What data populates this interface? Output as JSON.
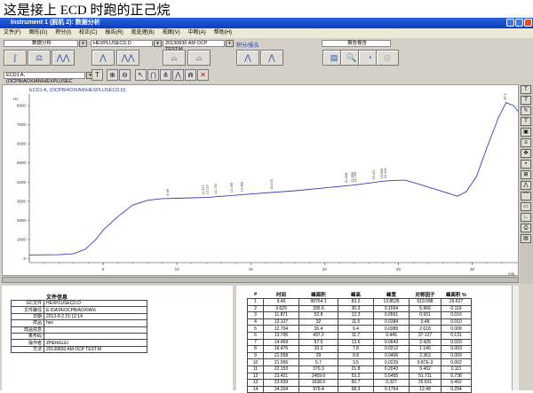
{
  "caption": "这是接上 ECD 时跑的正己烷",
  "window": {
    "title": "Instrument 1 (脱机 2): 数据分析"
  },
  "menu": [
    "文件(F)",
    "图形(G)",
    "积分(I)",
    "校正(C)",
    "报告(R)",
    "批处理(B)",
    "视图(V)",
    "中断(A)",
    "帮助(H)"
  ],
  "toolbar": {
    "view_combo": "数据分析",
    "file_combo": "HEXPLUSECD.D",
    "method_combo": "20130830 AM OCP TEST.M",
    "integration_label": "积分/报告",
    "report_combo": "报告报告",
    "signal_combo": "ECD1 A,  (OCPBIAOXIAN\\HEXPLUSEC"
  },
  "chart": {
    "signal_title": "ECD1 A,  (OCPBIAOXIAN\\HEXPLUSECD.D)",
    "y_unit": "Hz",
    "x_unit": "min",
    "y_ticks": [
      0,
      1000,
      2000,
      3000,
      4000,
      5000,
      6000,
      7000,
      8000
    ],
    "x_ticks": [
      5,
      10,
      15,
      20,
      25,
      30
    ],
    "x_range": [
      0,
      33.1
    ],
    "y_range": [
      -200,
      8600
    ],
    "curve": [
      [
        0,
        200
      ],
      [
        2,
        210
      ],
      [
        3,
        260
      ],
      [
        3.8,
        500
      ],
      [
        4.5,
        1000
      ],
      [
        5,
        1500
      ],
      [
        6,
        2200
      ],
      [
        7,
        2800
      ],
      [
        8,
        3050
      ],
      [
        9,
        3140
      ],
      [
        10,
        3160
      ],
      [
        12,
        3200
      ],
      [
        15,
        3380
      ],
      [
        18,
        3550
      ],
      [
        20,
        3700
      ],
      [
        22,
        3850
      ],
      [
        24,
        4050
      ],
      [
        25,
        4100
      ],
      [
        25.5,
        4100
      ],
      [
        27,
        3750
      ],
      [
        29,
        3270
      ],
      [
        29.6,
        3500
      ],
      [
        30.3,
        4300
      ],
      [
        31,
        5800
      ],
      [
        31.8,
        7400
      ],
      [
        32.3,
        8150
      ],
      [
        32.8,
        8000
      ],
      [
        33.1,
        7700
      ]
    ],
    "peak_labels": [
      "9.46",
      "11.871",
      "12.137",
      "12.704",
      "13.795",
      "14.469",
      "16.476",
      "21.558",
      "21.956",
      "22.153",
      "23.421",
      "23.939",
      "24.204",
      "32.3"
    ]
  },
  "info": {
    "title": "文件信息",
    "rows": [
      [
        "GC文件",
        "HEXPLUSECD.D"
      ],
      [
        "文件路径",
        "E:\\DATA\\OCPBIAOXIAN\\"
      ],
      [
        "日期",
        "2013-9-2 21:12:14"
      ],
      [
        "样品",
        "hex"
      ],
      [
        "样品信息",
        ""
      ],
      [
        "条形码",
        ""
      ],
      [
        "操作者",
        "ZHENGLEI"
      ],
      [
        "方法",
        "20130830 AM OCP TEST.M"
      ]
    ]
  },
  "peaks": {
    "headers": [
      "#",
      "时间",
      "峰面积",
      "峰高",
      "峰宽",
      "对称因子",
      "峰面积 %"
    ],
    "rows": [
      [
        "1",
        "9.46",
        "98764.1",
        "83.2",
        "13.8535",
        "519.588",
        "29.627"
      ],
      [
        "2",
        "9.629",
        "395.6",
        "30.3",
        "0.1564",
        "5.966",
        "0.119"
      ],
      [
        "3",
        "11.871",
        "52.8",
        "12.3",
        "0.0561",
        "0.931",
        "0.016"
      ],
      [
        "4",
        "12.137",
        "32",
        "11.5",
        "0.0384",
        "0.48",
        "0.010"
      ],
      [
        "5",
        "12.704",
        "26.4",
        "9.4",
        "0.0389",
        "2.618",
        "0.008"
      ],
      [
        "6",
        "13.795",
        "437.2",
        "11.7",
        "0.445",
        "37.127",
        "0.131"
      ],
      [
        "7",
        "14.469",
        "67.6",
        "13.6",
        "0.0643",
        "2.428",
        "0.020"
      ],
      [
        "8",
        "16.476",
        "10.2",
        "7.8",
        "0.0212",
        "1.146",
        "0.003"
      ],
      [
        "9",
        "21.558",
        "29",
        "9.8",
        "0.0406",
        "2.363",
        "0.009"
      ],
      [
        "10",
        "21.956",
        "5.7",
        "3.5",
        "0.0229",
        "9.87E-3",
        "0.002"
      ],
      [
        "11",
        "22.153",
        "370.3",
        "21.8",
        "0.2043",
        "9.402",
        "0.111"
      ],
      [
        "12",
        "23.421",
        "2459.6",
        "53.2",
        "0.5455",
        "51.711",
        "0.738"
      ],
      [
        "13",
        "23.939",
        "1638.6",
        "60.7",
        "0.327",
        "26.601",
        "0.492"
      ],
      [
        "14",
        "24.204",
        "979.4",
        "68.3",
        "0.1764",
        "12.48",
        "0.294"
      ]
    ]
  }
}
